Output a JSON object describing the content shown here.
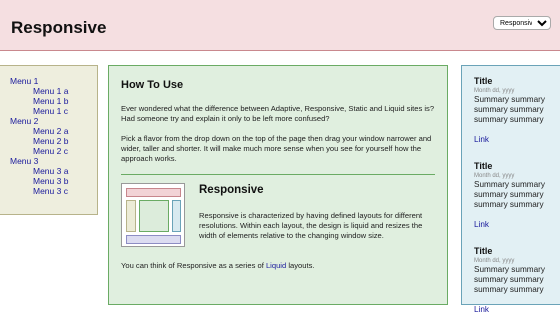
{
  "header": {
    "title": "Responsive",
    "select": {
      "selected": "Responsive"
    }
  },
  "nav": {
    "items": [
      {
        "label": "Menu 1",
        "level": 0
      },
      {
        "label": "Menu 1 a",
        "level": 1
      },
      {
        "label": "Menu 1 b",
        "level": 1
      },
      {
        "label": "Menu 1 c",
        "level": 1
      },
      {
        "label": "Menu 2",
        "level": 0
      },
      {
        "label": "Menu 2 a",
        "level": 1
      },
      {
        "label": "Menu 2 b",
        "level": 1
      },
      {
        "label": "Menu 2 c",
        "level": 1
      },
      {
        "label": "Menu 3",
        "level": 0
      },
      {
        "label": "Menu 3 a",
        "level": 1
      },
      {
        "label": "Menu 3 b",
        "level": 1
      },
      {
        "label": "Menu 3 c",
        "level": 1
      }
    ]
  },
  "main": {
    "heading": "How To Use",
    "para1": "Ever wondered what the difference between Adaptive, Responsive, Static and Liquid sites is? Had someone try and explain it only to be left more confused?",
    "para2": "Pick a flavor from the drop down on the top of the page then drag your window narrower and wider, taller and shorter. It will make much more sense when you see for yourself how the approach works.",
    "feature": {
      "title": "Responsive",
      "text": "Responsive is characterized by having defined layouts for different resolutions. Within each layout, the design is liquid and resizes the width of elements relative to the changing window size."
    },
    "series_prefix": "You can think of Responsive as a series of ",
    "series_link": "Liquid",
    "series_suffix": " layouts."
  },
  "aside": {
    "items": [
      {
        "title": "Title",
        "date": "Month dd, yyyy",
        "summary": "Summary summary summary summary summary summary",
        "link": "Link"
      },
      {
        "title": "Title",
        "date": "Month dd, yyyy",
        "summary": "Summary summary summary summary summary summary",
        "link": "Link"
      },
      {
        "title": "Title",
        "date": "Month dd, yyyy",
        "summary": "Summary summary summary summary summary summary",
        "link": "Link"
      }
    ]
  }
}
